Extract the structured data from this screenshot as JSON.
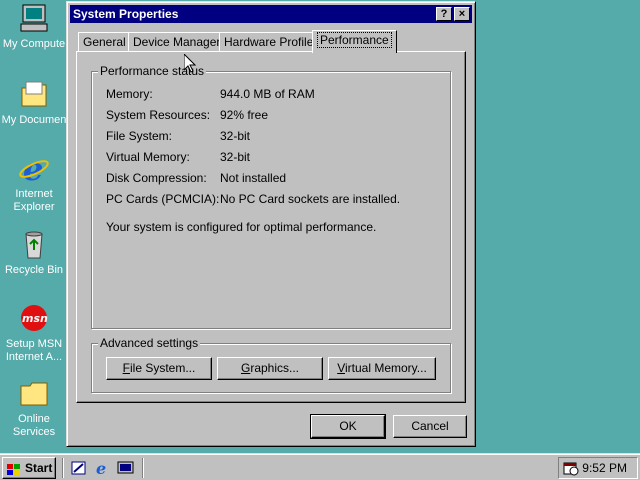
{
  "desktop": {
    "icons": [
      {
        "label": "My Compute"
      },
      {
        "label": "My Documen"
      },
      {
        "label": "Internet"
      },
      {
        "label": "Explorer"
      },
      {
        "label": "Recycle Bin"
      },
      {
        "label": "Setup MSN"
      },
      {
        "label": "Internet A..."
      },
      {
        "label": "Online"
      },
      {
        "label": "Services"
      }
    ]
  },
  "window": {
    "title": "System Properties",
    "help_glyph": "?",
    "close_glyph": "×",
    "tabs": [
      {
        "label": "General"
      },
      {
        "label": "Device Manager"
      },
      {
        "label": "Hardware Profiles"
      },
      {
        "label": "Performance"
      }
    ],
    "performance_status": {
      "legend": "Performance status",
      "rows": [
        {
          "key": "Memory:",
          "value": "944.0 MB of RAM"
        },
        {
          "key": "System Resources:",
          "value": "92% free"
        },
        {
          "key": "File System:",
          "value": "32-bit"
        },
        {
          "key": "Virtual Memory:",
          "value": "32-bit"
        },
        {
          "key": "Disk Compression:",
          "value": "Not installed"
        },
        {
          "key": "PC Cards (PCMCIA):",
          "value": "No PC Card sockets are installed."
        }
      ],
      "message": "Your system is configured for optimal performance."
    },
    "advanced": {
      "legend": "Advanced settings",
      "file_system_pre": "",
      "file_system_u": "F",
      "file_system_post": "ile System...",
      "graphics_pre": "",
      "graphics_u": "G",
      "graphics_post": "raphics...",
      "vm_pre": "",
      "vm_u": "V",
      "vm_post": "irtual Memory..."
    },
    "ok_label": "OK",
    "cancel_label": "Cancel"
  },
  "taskbar": {
    "start_label": "Start",
    "time": "9:52 PM"
  },
  "colors": {
    "desktop": "#55aaaa",
    "titlebar": "#000080",
    "face": "#c0c0c0"
  }
}
